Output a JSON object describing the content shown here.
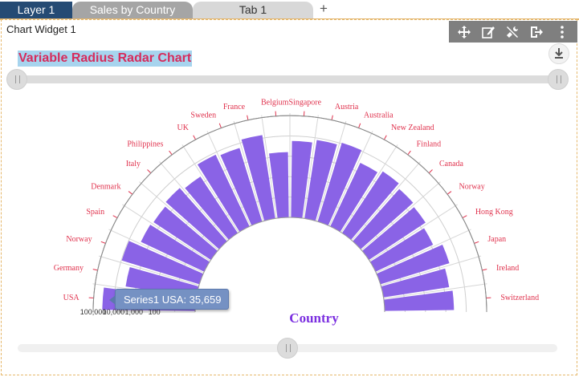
{
  "tabs": [
    {
      "label": "Layer 1"
    },
    {
      "label": "Sales by Country"
    },
    {
      "label": "Tab 1"
    }
  ],
  "add_tab_glyph": "+",
  "widget": {
    "title": "Chart Widget 1",
    "toolbar_icons": [
      "move-icon",
      "edit-icon",
      "tools-icon",
      "export-icon",
      "more-vertical-icon"
    ],
    "download_icon": "download-icon"
  },
  "chart_data": {
    "type": "bar",
    "title": "Variable Radius Radar Chart",
    "xlabel": "Country",
    "ylabel": "",
    "scale": "log",
    "ylim": [
      1,
      100000
    ],
    "tick_labels": [
      "100,000",
      "10,000",
      "1,000",
      "100"
    ],
    "categories": [
      "USA",
      "Germany",
      "Norway",
      "Spain",
      "Denmark",
      "Italy",
      "Philippines",
      "UK",
      "Sweden",
      "France",
      "Belgium",
      "Singapore",
      "Austria",
      "Australia",
      "New Zealand",
      "Finland",
      "Canada",
      "Norway",
      "Hong Kong",
      "Japan",
      "Ireland",
      "Switzerland"
    ],
    "series": [
      {
        "name": "Series1",
        "values": [
          35659,
          3200,
          9500,
          2700,
          2300,
          3100,
          2100,
          7800,
          6000,
          14000,
          1600,
          5600,
          8000,
          11000,
          2800,
          4200,
          2700,
          2100,
          1300,
          3400,
          1800,
          2500
        ]
      }
    ],
    "bar_color": "#8a63e6",
    "title_color": "#d62b5c",
    "title_bg": "#a7d4ee",
    "label_color": "#e0334e",
    "xlabel_color": "#7b2fe0",
    "tooltip": {
      "series": "Series1",
      "category": "USA",
      "value": "35,659"
    }
  }
}
